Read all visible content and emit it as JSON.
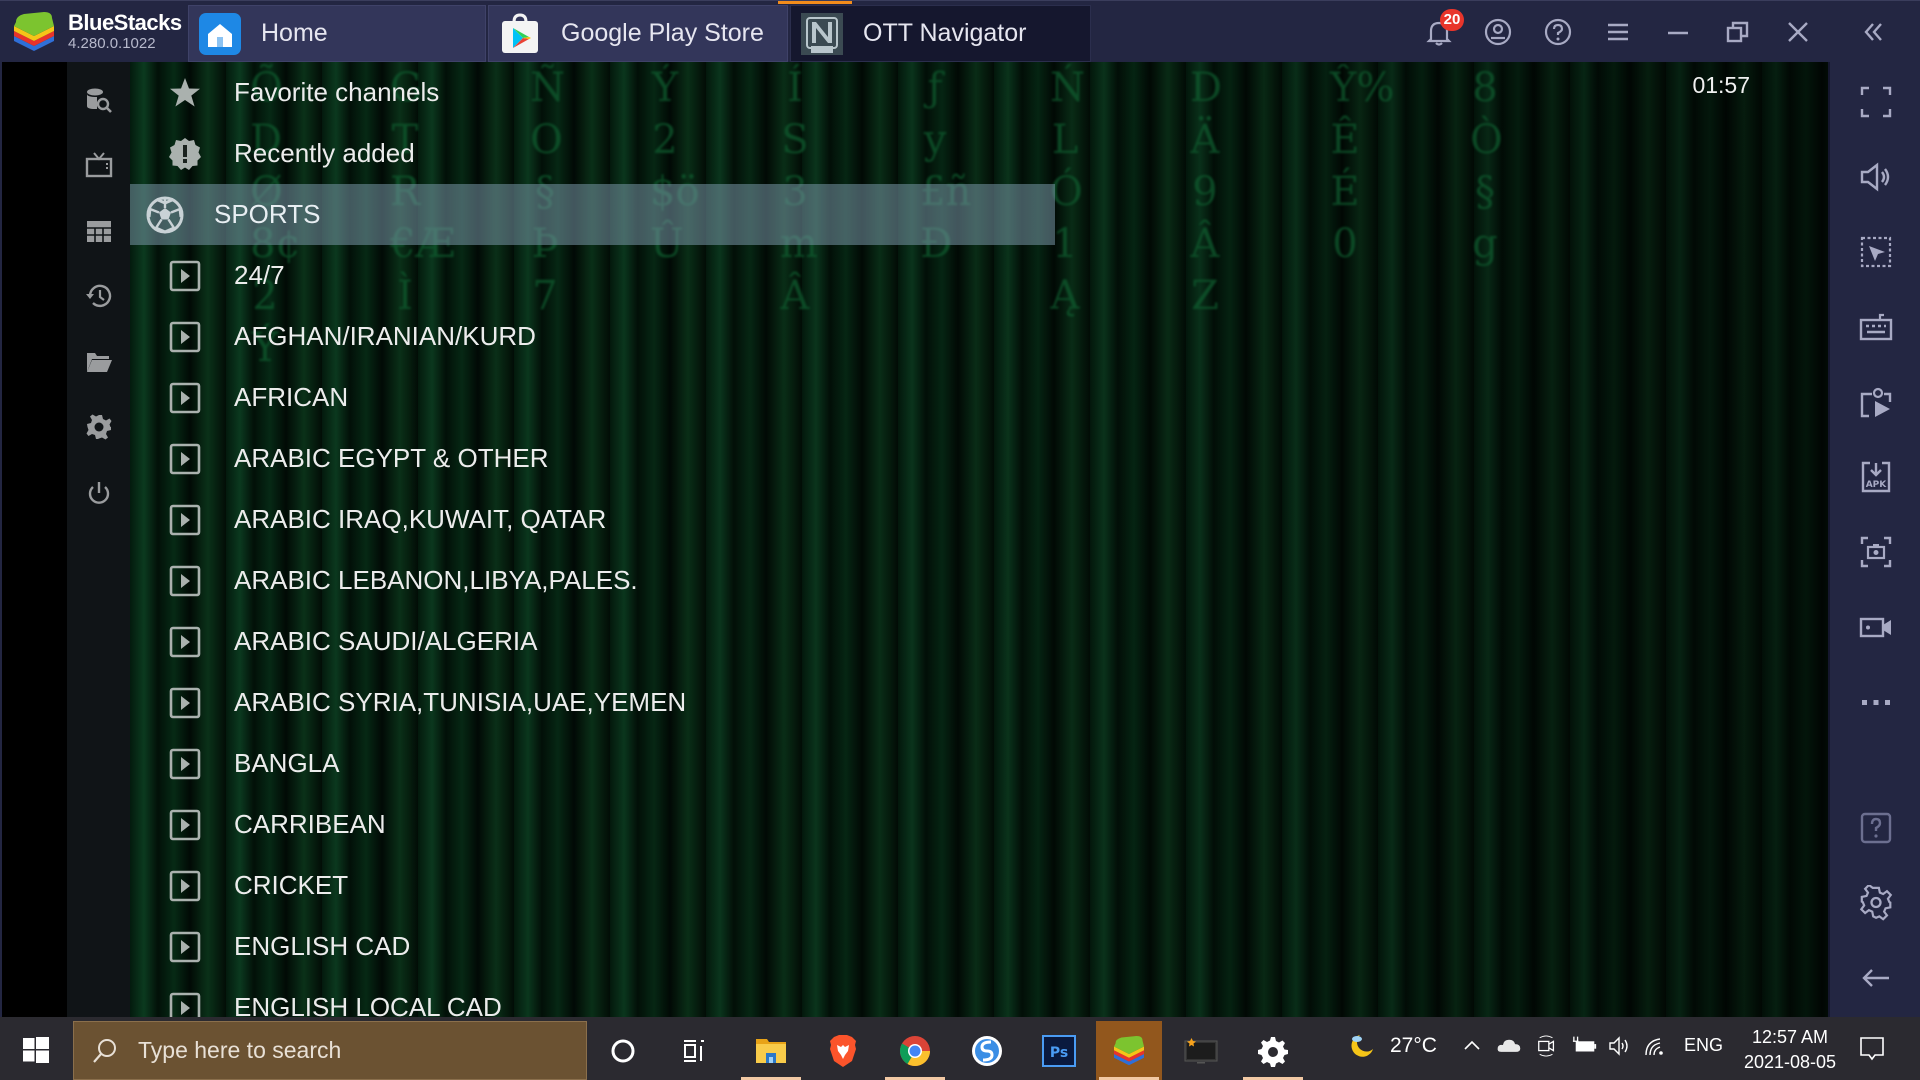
{
  "titlebar": {
    "brand_name": "BlueStacks",
    "brand_version": "4.280.0.1022",
    "tabs": [
      {
        "label": "Home",
        "icon": "home-icon",
        "active": false
      },
      {
        "label": "Google Play Store",
        "icon": "play-store-icon",
        "active": false
      },
      {
        "label": "OTT Navigator",
        "icon": "ott-navigator-icon",
        "active": true
      }
    ],
    "notification_count": "20",
    "buttons": [
      "bell-icon",
      "account-icon",
      "help-icon",
      "menu-icon",
      "minimize-icon",
      "restore-icon",
      "close-icon",
      "collapse-sidebar-icon"
    ],
    "accent_color": "#f28c1b"
  },
  "app": {
    "clock": "01:57",
    "nav_icons": [
      "search-database-icon",
      "tv-icon",
      "grid-icon",
      "history-icon",
      "folder-icon",
      "settings-icon",
      "power-icon"
    ],
    "list": [
      {
        "label": "Favorite channels",
        "icon": "star-icon",
        "selected": false
      },
      {
        "label": "Recently added",
        "icon": "new-badge-icon",
        "selected": false
      },
      {
        "label": "SPORTS",
        "icon": "soccer-ball-icon",
        "selected": true
      },
      {
        "label": "24/7",
        "icon": "play-box-icon",
        "selected": false
      },
      {
        "label": "AFGHAN/IRANIAN/KURD",
        "icon": "play-box-icon",
        "selected": false
      },
      {
        "label": "AFRICAN",
        "icon": "play-box-icon",
        "selected": false
      },
      {
        "label": "ARABIC EGYPT & OTHER",
        "icon": "play-box-icon",
        "selected": false
      },
      {
        "label": "ARABIC IRAQ,KUWAIT, QATAR",
        "icon": "play-box-icon",
        "selected": false
      },
      {
        "label": "ARABIC LEBANON,LIBYA,PALES.",
        "icon": "play-box-icon",
        "selected": false
      },
      {
        "label": "ARABIC SAUDI/ALGERIA",
        "icon": "play-box-icon",
        "selected": false
      },
      {
        "label": "ARABIC SYRIA,TUNISIA,UAE,YEMEN",
        "icon": "play-box-icon",
        "selected": false
      },
      {
        "label": "BANGLA",
        "icon": "play-box-icon",
        "selected": false
      },
      {
        "label": "CARRIBEAN",
        "icon": "play-box-icon",
        "selected": false
      },
      {
        "label": "CRICKET",
        "icon": "play-box-icon",
        "selected": false
      },
      {
        "label": "ENGLISH CAD",
        "icon": "play-box-icon",
        "selected": false
      },
      {
        "label": "ENGLISH LOCAL CAD",
        "icon": "play-box-icon",
        "selected": false
      }
    ],
    "matrix_glyphs": [
      "ÕDØ8¢2Ý",
      "GTR€ÆÌ",
      "ÑO§Þ7",
      "Ý2$öÛ",
      "ÍS3mÂ",
      "ƒy£ñÐ",
      "ŃLÓ1Ą",
      "DÄ9ÂZ",
      "Ŷ%ÊÉ0",
      "8Ò§g"
    ]
  },
  "right_toolbar": {
    "icons": [
      "fullscreen-icon",
      "volume-icon",
      "select-pointer-icon",
      "keyboard-icon",
      "media-manager-icon",
      "install-apk-icon",
      "screenshot-icon",
      "record-video-icon",
      "more-icon",
      "help-box-icon",
      "settings-icon",
      "back-arrow-icon"
    ]
  },
  "taskbar": {
    "search_placeholder": "Type here to search",
    "apps": [
      "cortana-icon",
      "task-view-icon",
      "file-explorer-icon",
      "brave-icon",
      "chrome-icon",
      "simplenote-icon",
      "photoshop-icon",
      "bluestacks-icon",
      "tv-app-icon",
      "settings-icon"
    ],
    "photoshop_label": "Ps",
    "weather_temp": "27°C",
    "language": "ENG",
    "time": "12:57 AM",
    "date": "2021-08-05"
  }
}
